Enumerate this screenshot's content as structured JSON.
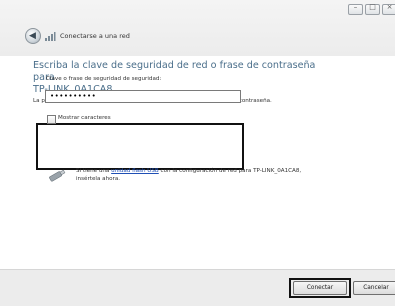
{
  "window": {
    "title": "Conectarse a una red",
    "controls": [
      "minimize",
      "maximize",
      "close"
    ]
  },
  "main": {
    "heading_line1": "Escriba la clave de seguridad de red o frase de contraseña para",
    "heading_line2": "TP-LINK_0A1CA8",
    "description": "La persona que configura la red puede proporcionarle la clave o frase de contraseña.",
    "key_label": "Clave o frase de seguridad de seguridad:",
    "key_value": "••••••••••",
    "show_chars_label": "Mostrar caracteres",
    "show_chars_checked": false,
    "usb_text_before": "Si tiene una ",
    "usb_link": "unidad flash USB",
    "usb_text_after": " con la configuración de red para TP-LINK_0A1CA8,",
    "usb_text_line2": "insértela ahora."
  },
  "footer": {
    "connect_label": "Conectar",
    "cancel_label": "Cancelar"
  },
  "icons": {
    "back": "back-arrow-icon",
    "network": "wireless-network-icon",
    "usb": "usb-flash-drive-icon"
  }
}
